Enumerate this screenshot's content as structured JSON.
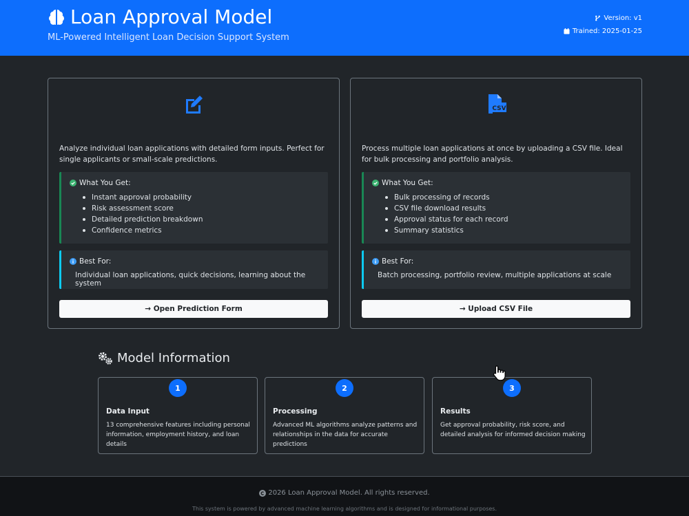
{
  "header": {
    "title": "Loan Approval Model",
    "subtitle": "ML-Powered Intelligent Loan Decision Support System",
    "version": "Version: v1",
    "trained": "Trained: 2025-01-25",
    "brain_icon": "brain-icon"
  },
  "cards": [
    {
      "icon": "edit-icon",
      "description": "Analyze individual loan applications with detailed form inputs. Perfect for single applicants or small-scale predictions.",
      "gets_title": "What You Get:",
      "gets": [
        "Instant approval probability",
        "Risk assessment score",
        "Detailed prediction breakdown",
        "Confidence metrics"
      ],
      "best_title": "Best For:",
      "best_text": "Individual loan applications, quick decisions, learning about the system",
      "button": "→ Open Prediction Form"
    },
    {
      "icon": "csv-file-icon",
      "description": "Process multiple loan applications at once by uploading a CSV file. Ideal for bulk processing and portfolio analysis.",
      "gets_title": "What You Get:",
      "gets": [
        "Bulk processing of records",
        "CSV file download results",
        "Approval status for each record",
        "Summary statistics"
      ],
      "best_title": "Best For:",
      "best_text": "Batch processing, portfolio review, multiple applications at scale",
      "button": "→ Upload CSV File"
    }
  ],
  "model_info": {
    "title": "Model Information",
    "steps": [
      {
        "num": "1",
        "title": "Data Input",
        "desc": "13 comprehensive features including personal information, employment history, and loan details"
      },
      {
        "num": "2",
        "title": "Processing",
        "desc": "Advanced ML algorithms analyze patterns and relationships in the data for accurate predictions"
      },
      {
        "num": "3",
        "title": "Results",
        "desc": "Get approval probability, risk score, and detailed analysis for informed decision making"
      }
    ]
  },
  "footer": {
    "copyright": "2026 Loan Approval Model. All rights reserved.",
    "note": "This system is powered by advanced machine learning algorithms and is designed for informational purposes."
  },
  "colors": {
    "primary": "#0d6efd",
    "success": "#198754",
    "info": "#0dcaf0",
    "background": "#212529"
  }
}
